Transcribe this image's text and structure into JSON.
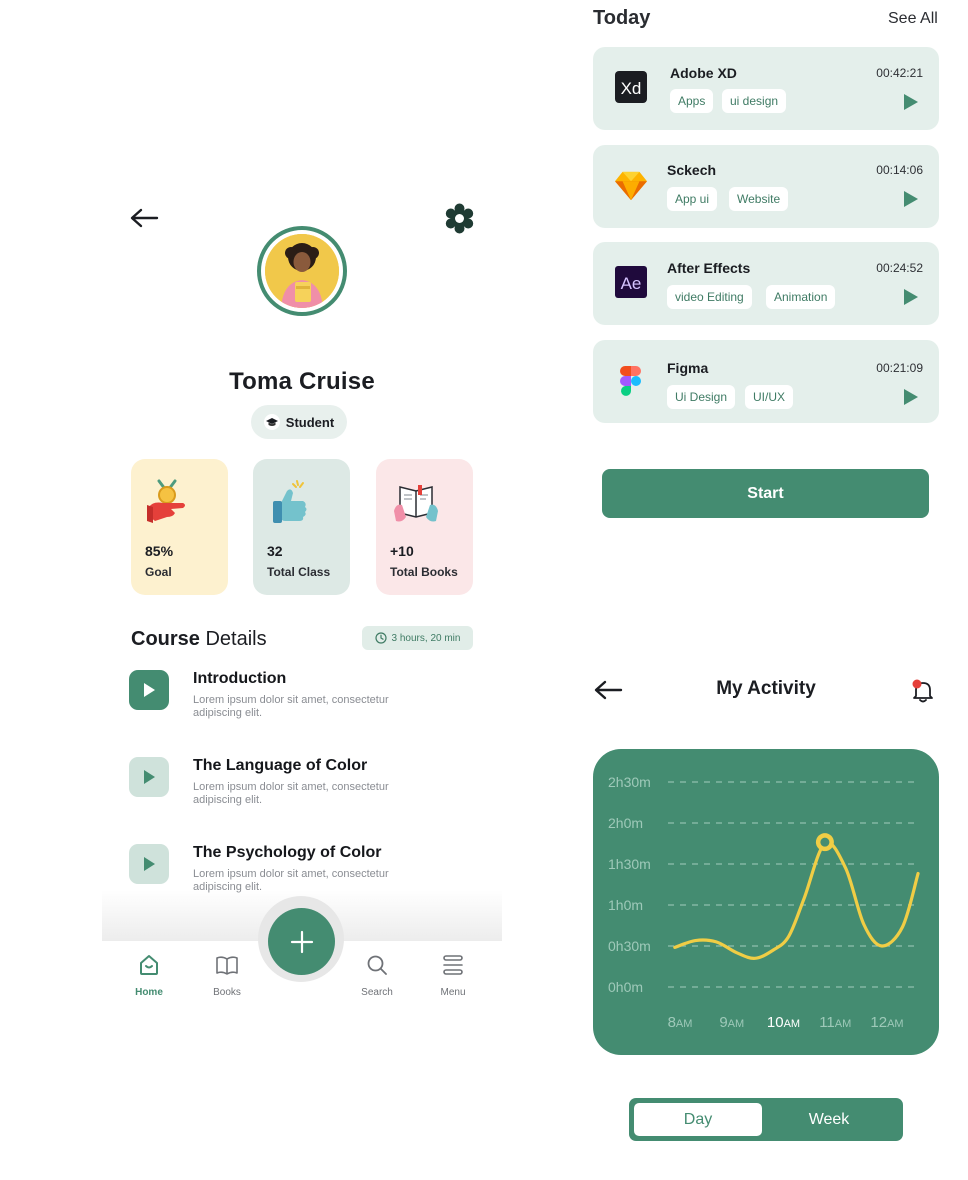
{
  "profile": {
    "name": "Toma Cruise",
    "role": "Student",
    "stats": [
      {
        "value": "85%",
        "label": "Goal",
        "bg": "#fdf1cf"
      },
      {
        "value": "32",
        "label": "Total Class",
        "bg": "#dde9e5"
      },
      {
        "value": "+10",
        "label": "Total Books",
        "bg": "#fbe7e8"
      }
    ],
    "course": {
      "title_bold": "Course",
      "title_rest": " Details",
      "duration": "3 hours, 20 min",
      "lessons": [
        {
          "title": "Introduction",
          "desc": "Lorem ipsum dolor sit amet, consectetur adipiscing elit."
        },
        {
          "title": "The Language of Color",
          "desc": "Lorem ipsum dolor sit amet, consectetur adipiscing elit."
        },
        {
          "title": "The Psychology of Color",
          "desc": "Lorem ipsum dolor sit amet, consectetur adipiscing elit."
        }
      ]
    },
    "nav": {
      "home": "Home",
      "books": "Books",
      "search": "Search",
      "menu": "Menu"
    }
  },
  "today": {
    "title": "Today",
    "see_all": "See All",
    "tasks": [
      {
        "name": "Adobe XD",
        "time": "00:42:21",
        "tags": [
          "Apps",
          "ui design"
        ],
        "logo": "adobe-xd-logo"
      },
      {
        "name": "Sckech",
        "time": "00:14:06",
        "tags": [
          "App ui",
          "Website"
        ],
        "logo": "sketch-logo"
      },
      {
        "name": "After Effects",
        "time": "00:24:52",
        "tags": [
          "video Editing",
          "Animation"
        ],
        "logo": "after-effects-logo"
      },
      {
        "name": "Figma",
        "time": "00:21:09",
        "tags": [
          "Ui Design",
          "UI/UX"
        ],
        "logo": "figma-logo"
      }
    ],
    "start_label": "Start"
  },
  "activity": {
    "title": "My Activity",
    "toggle": {
      "day": "Day",
      "week": "Week",
      "selected": "Day"
    }
  },
  "chart_data": {
    "type": "line",
    "y_ticks": [
      "0h0m",
      "0h30m",
      "1h0m",
      "1h30m",
      "2h0m",
      "2h30m"
    ],
    "x_ticks": [
      {
        "num": "8",
        "suffix": "AM"
      },
      {
        "num": "9",
        "suffix": "AM"
      },
      {
        "num": "10",
        "suffix": "AM"
      },
      {
        "num": "11",
        "suffix": "AM"
      },
      {
        "num": "12",
        "suffix": "AM"
      }
    ],
    "ylim_minutes": [
      0,
      150
    ],
    "x_hours": [
      7.9,
      8.3,
      8.7,
      9.1,
      9.45,
      9.8,
      10.1,
      10.4,
      10.8,
      11.2,
      11.55,
      11.9,
      12.3,
      12.6
    ],
    "y_minutes": [
      29,
      34,
      33,
      25,
      21,
      27,
      37,
      65,
      105,
      87,
      46,
      30,
      44,
      83
    ],
    "highlight": {
      "x_hour": 10.8,
      "y_minutes": 106
    },
    "highlight_tick": "10AM",
    "grid": "dashed-horizontal",
    "colors": {
      "line": "#f0cd45",
      "background": "#448c71",
      "grid": "#8fbfae",
      "ticks": "#9ec9b9",
      "active_tick": "#ffffff"
    }
  },
  "colors": {
    "primary": "#448c71",
    "card_bg": "#e4efeb",
    "tag_text": "#3f7b64"
  }
}
